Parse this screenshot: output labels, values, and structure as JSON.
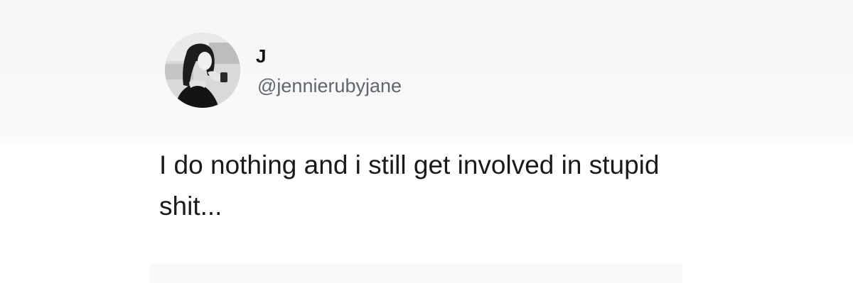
{
  "tweet": {
    "author": {
      "display_name": "J",
      "handle": "@jennierubyjane",
      "avatar_icon": "profile-photo-icon"
    },
    "text": "I do nothing and i still get involved in stupid shit..."
  },
  "colors": {
    "text_primary": "#1a1a1a",
    "text_secondary": "#5f6670",
    "background": "#ffffff"
  }
}
